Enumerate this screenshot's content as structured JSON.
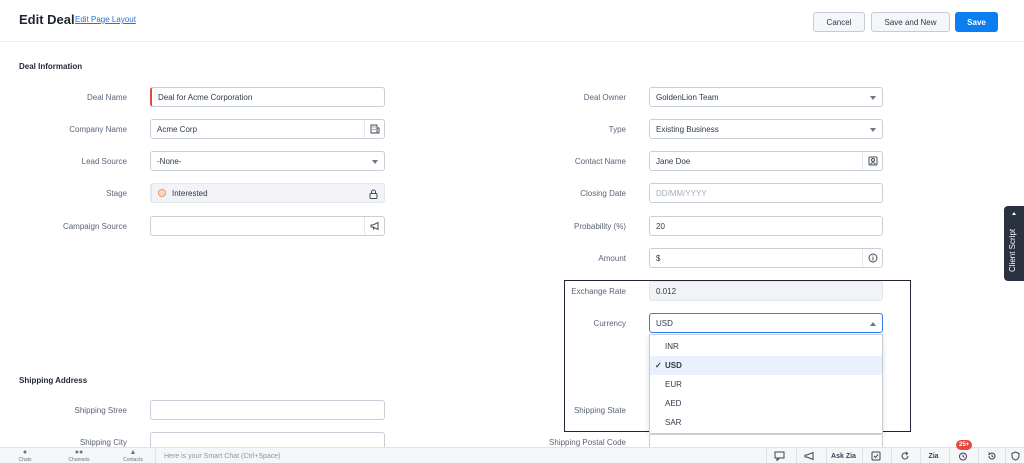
{
  "header": {
    "title": "Edit Deal",
    "edit_layout_link": "Edit Page Layout",
    "cancel_label": "Cancel",
    "save_new_label": "Save and New",
    "save_label": "Save"
  },
  "sections": {
    "deal_information": "Deal Information",
    "shipping_address": "Shipping Address"
  },
  "fields": {
    "deal_name": {
      "label": "Deal Name",
      "value": "Deal for Acme Corporation"
    },
    "company_name": {
      "label": "Company Name",
      "value": "Acme Corp"
    },
    "lead_source": {
      "label": "Lead Source",
      "value": "-None-"
    },
    "stage": {
      "label": "Stage",
      "value": "Interested"
    },
    "campaign_source": {
      "label": "Campaign Source",
      "value": ""
    },
    "deal_owner": {
      "label": "Deal Owner",
      "value": "GoldenLion Team"
    },
    "type": {
      "label": "Type",
      "value": "Existing Business"
    },
    "contact_name": {
      "label": "Contact Name",
      "value": "Jane Doe"
    },
    "closing_date": {
      "label": "Closing Date",
      "placeholder": "DD/MM/YYYY"
    },
    "probability": {
      "label": "Probability (%)",
      "value": "20"
    },
    "amount": {
      "label": "Amount",
      "value": "$"
    },
    "exchange_rate": {
      "label": "Exchange Rate",
      "value": "0.012"
    },
    "currency": {
      "label": "Currency",
      "value": "USD"
    },
    "shipping_street": {
      "label": "Shipping Stree",
      "value": ""
    },
    "shipping_city": {
      "label": "Shipping City",
      "value": ""
    },
    "shipping_state": {
      "label": "Shipping State"
    },
    "shipping_postal_code": {
      "label": "Shipping Postal Code",
      "value": ""
    }
  },
  "currency_dropdown": {
    "options": [
      "INR",
      "USD",
      "EUR",
      "AED",
      "SAR"
    ],
    "selected": "USD",
    "check": "✓"
  },
  "client_script": {
    "label": "Client Script"
  },
  "bottombar": {
    "chats": "Chats",
    "channels": "Channels",
    "contacts": "Contacts",
    "smart_chat_placeholder": "Here is your Smart Chat (Ctrl+Space)",
    "ask_zia": "Ask Zia",
    "zia_label": "Zia",
    "notification_count": "25+"
  },
  "colors": {
    "primary": "#0b7ff0",
    "mandatory": "#e5483e",
    "highlight_border": "#1f2533",
    "dropdown_selected": "#e9f1fc"
  }
}
